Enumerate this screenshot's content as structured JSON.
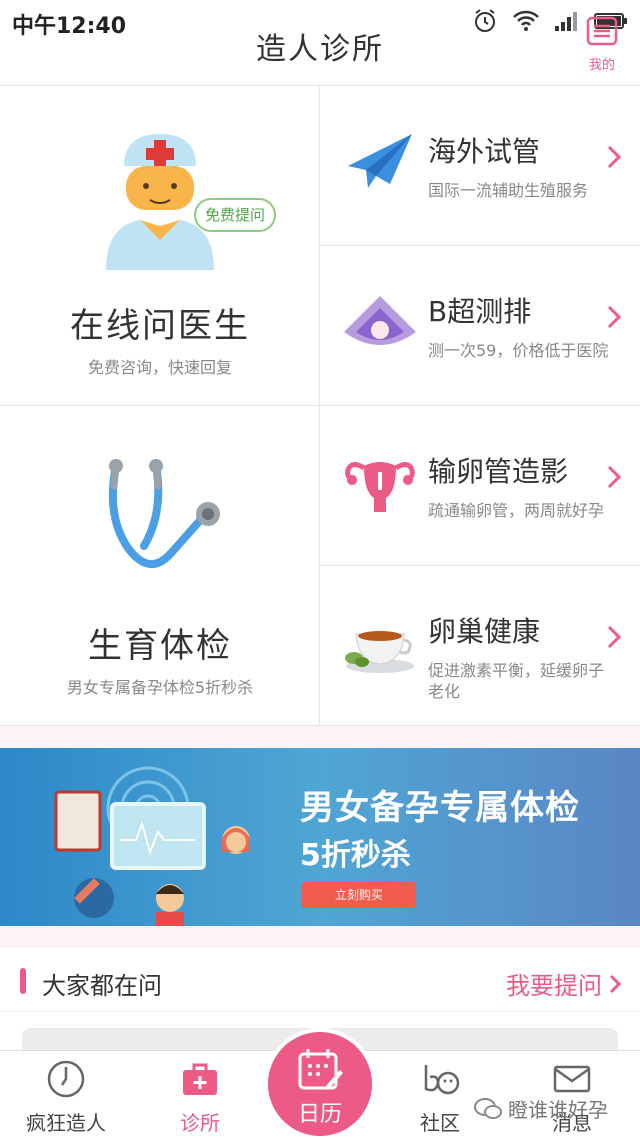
{
  "status_bar": {
    "time": "中午12:40"
  },
  "header": {
    "title": "造人诊所",
    "mine_label": "我的"
  },
  "cards": {
    "online_doctor": {
      "title": "在线问医生",
      "subtitle": "免费咨询，快速回复",
      "bubble": "免费提问"
    },
    "checkup": {
      "title": "生育体检",
      "subtitle": "男女专属备孕体检5折秒杀"
    },
    "ivf": {
      "title": "海外试管",
      "subtitle": "国际一流辅助生殖服务"
    },
    "ultrasound": {
      "title": "B超测排",
      "subtitle": "测一次59，价格低于医院"
    },
    "tube": {
      "title": "输卵管造影",
      "subtitle": "疏通输卵管，两周就好孕"
    },
    "ovary": {
      "title": "卵巢健康",
      "subtitle": "促进激素平衡，延缓卵子老化"
    }
  },
  "banner": {
    "line1": "男女备孕专属体检",
    "line2": "5折秒杀",
    "button": "立刻购买"
  },
  "section": {
    "title": "大家都在问",
    "link": "我要提问"
  },
  "tabbar": {
    "tabs": [
      {
        "label": "疯狂造人"
      },
      {
        "label": "诊所"
      },
      {
        "label": "日历"
      },
      {
        "label": "社区"
      },
      {
        "label": "消息"
      }
    ]
  },
  "watermark": "瞪谁谁好孕",
  "colors": {
    "accent": "#ec5b85",
    "banner": "#3a93cc",
    "text": "#333333",
    "muted": "#888888"
  }
}
